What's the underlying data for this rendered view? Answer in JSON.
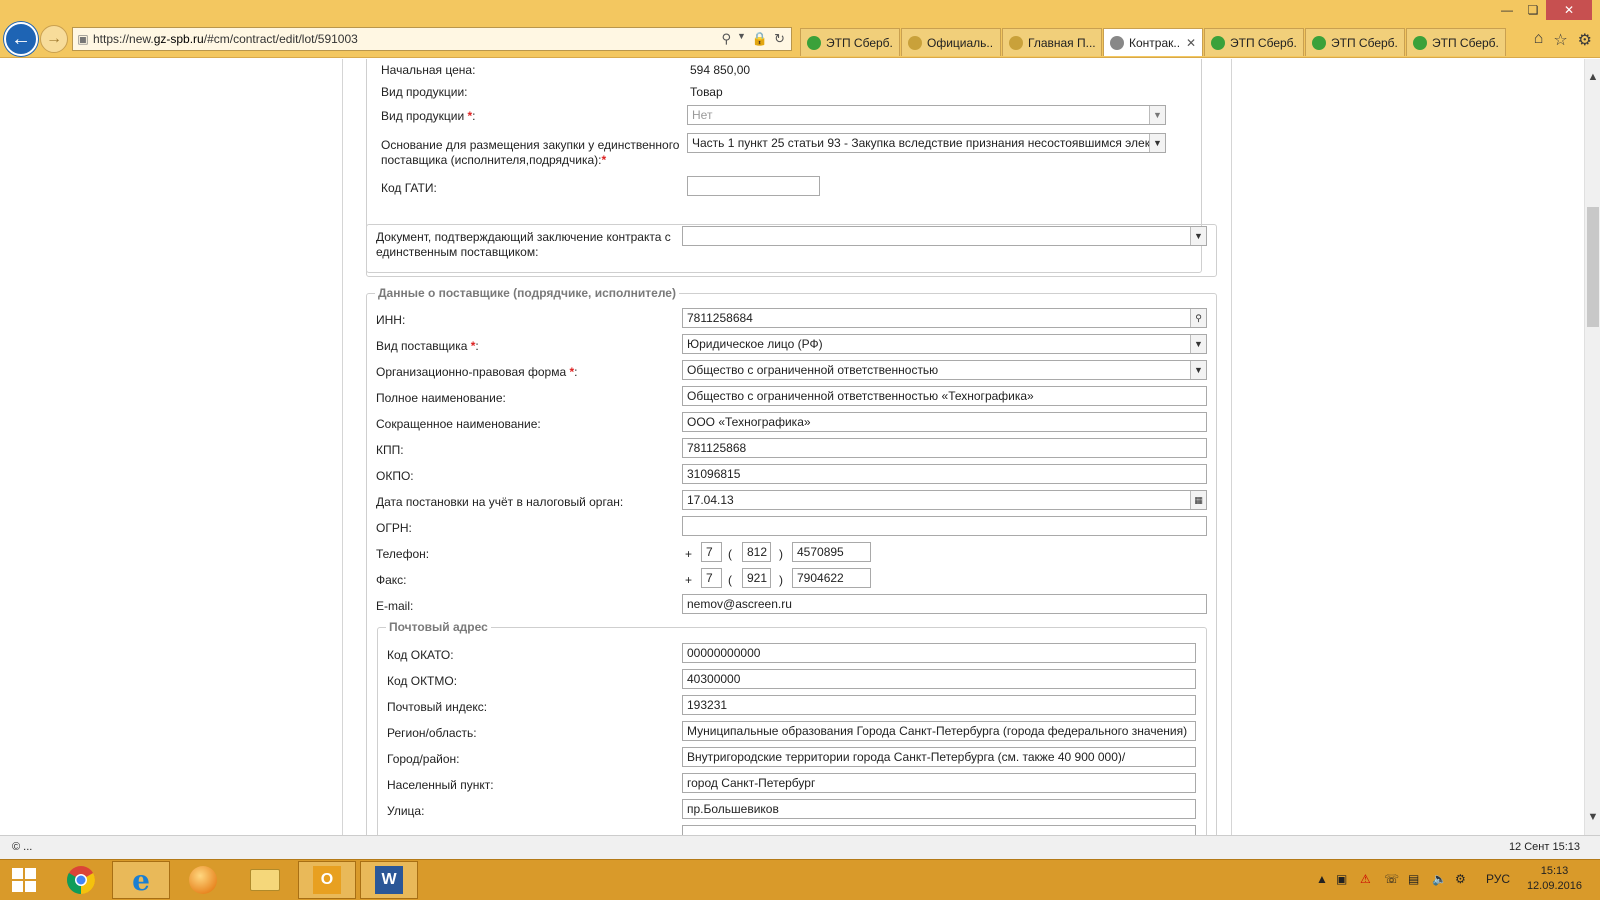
{
  "browser": {
    "url_prefix": "https://new.",
    "url_domain": "gz-spb.ru",
    "url_path": "/#cm/contract/edit/lot/591003",
    "tabs": [
      {
        "label": "ЭТП Сберб...",
        "icon": "sber-icon",
        "color": "#3aa13a",
        "active": false
      },
      {
        "label": "Официаль...",
        "icon": "emblem-icon",
        "color": "#c9a13a",
        "active": false
      },
      {
        "label": "Главная П...",
        "icon": "emblem-icon",
        "color": "#c9a13a",
        "active": false
      },
      {
        "label": "Контрак...",
        "icon": "tools-icon",
        "color": "#666666",
        "active": true
      },
      {
        "label": "ЭТП Сберб...",
        "icon": "sber-icon",
        "color": "#3aa13a",
        "active": false
      },
      {
        "label": "ЭТП Сберб...",
        "icon": "sber-icon",
        "color": "#3aa13a",
        "active": false
      },
      {
        "label": "ЭТП Сберб...",
        "icon": "sber-icon",
        "color": "#3aa13a",
        "active": false
      }
    ]
  },
  "lot": {
    "start_price_label": "Начальная цена:",
    "start_price_value": "594 850,00",
    "product_type_label": "Вид продукции:",
    "product_type_value": "Товар",
    "product_type2_label": "Вид продукции",
    "product_type2_value": "Нет",
    "basis_label": "Основание для размещения закупки у единственного поставщика (исполнителя,подрядчика):",
    "basis_value": "Часть 1 пункт 25 статьи 93 -  Закупка вследствие признания несостоявшимся элек",
    "gati_label": "Код ГАТИ:",
    "gati_value": ""
  },
  "document": {
    "label": "Документ, подтверждающий заключение контракта с единственным поставщиком:",
    "value": ""
  },
  "supplier": {
    "legend": "Данные о поставщике (подрядчике, исполнителе)",
    "inn_label": "ИНН:",
    "inn_value": "7811258684",
    "type_label": "Вид поставщика",
    "type_value": "Юридическое лицо (РФ)",
    "form_label": "Организационно-правовая форма",
    "form_value": "Общество с ограниченной ответственностью",
    "full_name_label": "Полное наименование:",
    "full_name_value": "Общество с ограниченной ответственностью «Технографика»",
    "short_name_label": "Сокращенное наименование:",
    "short_name_value": "ООО «Технографика»",
    "kpp_label": "КПП:",
    "kpp_value": "781125868",
    "okpo_label": "ОКПО:",
    "okpo_value": "31096815",
    "tax_date_label": "Дата постановки на учёт в налоговый орган:",
    "tax_date_value": "17.04.13",
    "ogrn_label": "ОГРН:",
    "ogrn_value": "",
    "phone_label": "Телефон:",
    "phone_plus": "+",
    "phone_country": "7",
    "phone_open": "(",
    "phone_code": "812",
    "phone_close": ")",
    "phone_number": "4570895",
    "fax_label": "Факс:",
    "fax_plus": "+",
    "fax_country": "7",
    "fax_open": "(",
    "fax_code": "921",
    "fax_close": ")",
    "fax_number": "7904622",
    "email_label": "E-mail:",
    "email_value": "nemov@ascreen.ru"
  },
  "postal": {
    "legend": "Почтовый адрес",
    "okato_label": "Код ОКАТО:",
    "okato_value": "00000000000",
    "oktmo_label": "Код ОКТМО:",
    "oktmo_value": "40300000",
    "index_label": "Почтовый индекс:",
    "index_value": "193231",
    "region_label": "Регион/область:",
    "region_value": "Муниципальные образования Города Санкт-Петербурга (города федерального значения)",
    "city_label": "Город/район:",
    "city_value": "Внутригородские территории города Санкт-Петербурга (см. также 40 900 000)/",
    "locality_label": "Населенный пункт:",
    "locality_value": "город Санкт-Петербург",
    "street_label": "Улица:",
    "street_value": "пр.Большевиков"
  },
  "required_mark": "*",
  "status": {
    "left": "© ...",
    "right": "12 Сент 15:13"
  },
  "taskbar": {
    "lang": "РУС",
    "time": "15:13",
    "date": "12.09.2016"
  }
}
